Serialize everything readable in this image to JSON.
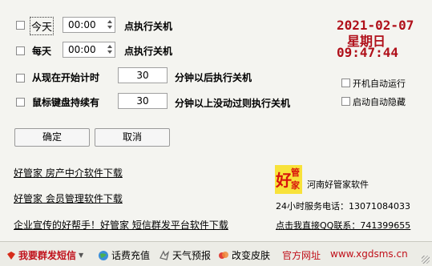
{
  "row_today": {
    "label": "今天",
    "time": "00:00",
    "action": "点执行关机"
  },
  "row_daily": {
    "label": "每天",
    "time": "00:00",
    "action": "点执行关机"
  },
  "row_timer": {
    "label": "从现在开始计时",
    "value": "30",
    "suffix": "分钟以后执行关机"
  },
  "row_idle": {
    "label": "鼠标键盘持续有",
    "value": "30",
    "suffix": "分钟以上没动过则执行关机"
  },
  "clock": {
    "date": "2021-02-07",
    "weekday": "星期日",
    "time": "09:47:44",
    "color": "#b0101a"
  },
  "options": {
    "autostart": "开机自动运行",
    "autohide": "启动自动隐藏"
  },
  "buttons": {
    "ok": "确定",
    "cancel": "取消"
  },
  "links": {
    "realty": "好管家 房产中介软件下载",
    "member": "好管家 会员管理软件下载",
    "sms": "企业宣传的好帮手！好管家 短信群发平台软件下载"
  },
  "company": {
    "logo_text_big": "好",
    "logo_text_small1": "管",
    "logo_text_small2": "家",
    "name": "河南好管家软件",
    "hotline": "24小时服务电话：13071084033",
    "qq": "点击我直接QQ联系：741399655"
  },
  "bottom": {
    "sms": "我要群发短信",
    "recharge": "话费充值",
    "weather": "天气预报",
    "skin": "改变皮肤",
    "site_label": "官方网址",
    "site_url": "www.xgdsms.cn"
  }
}
